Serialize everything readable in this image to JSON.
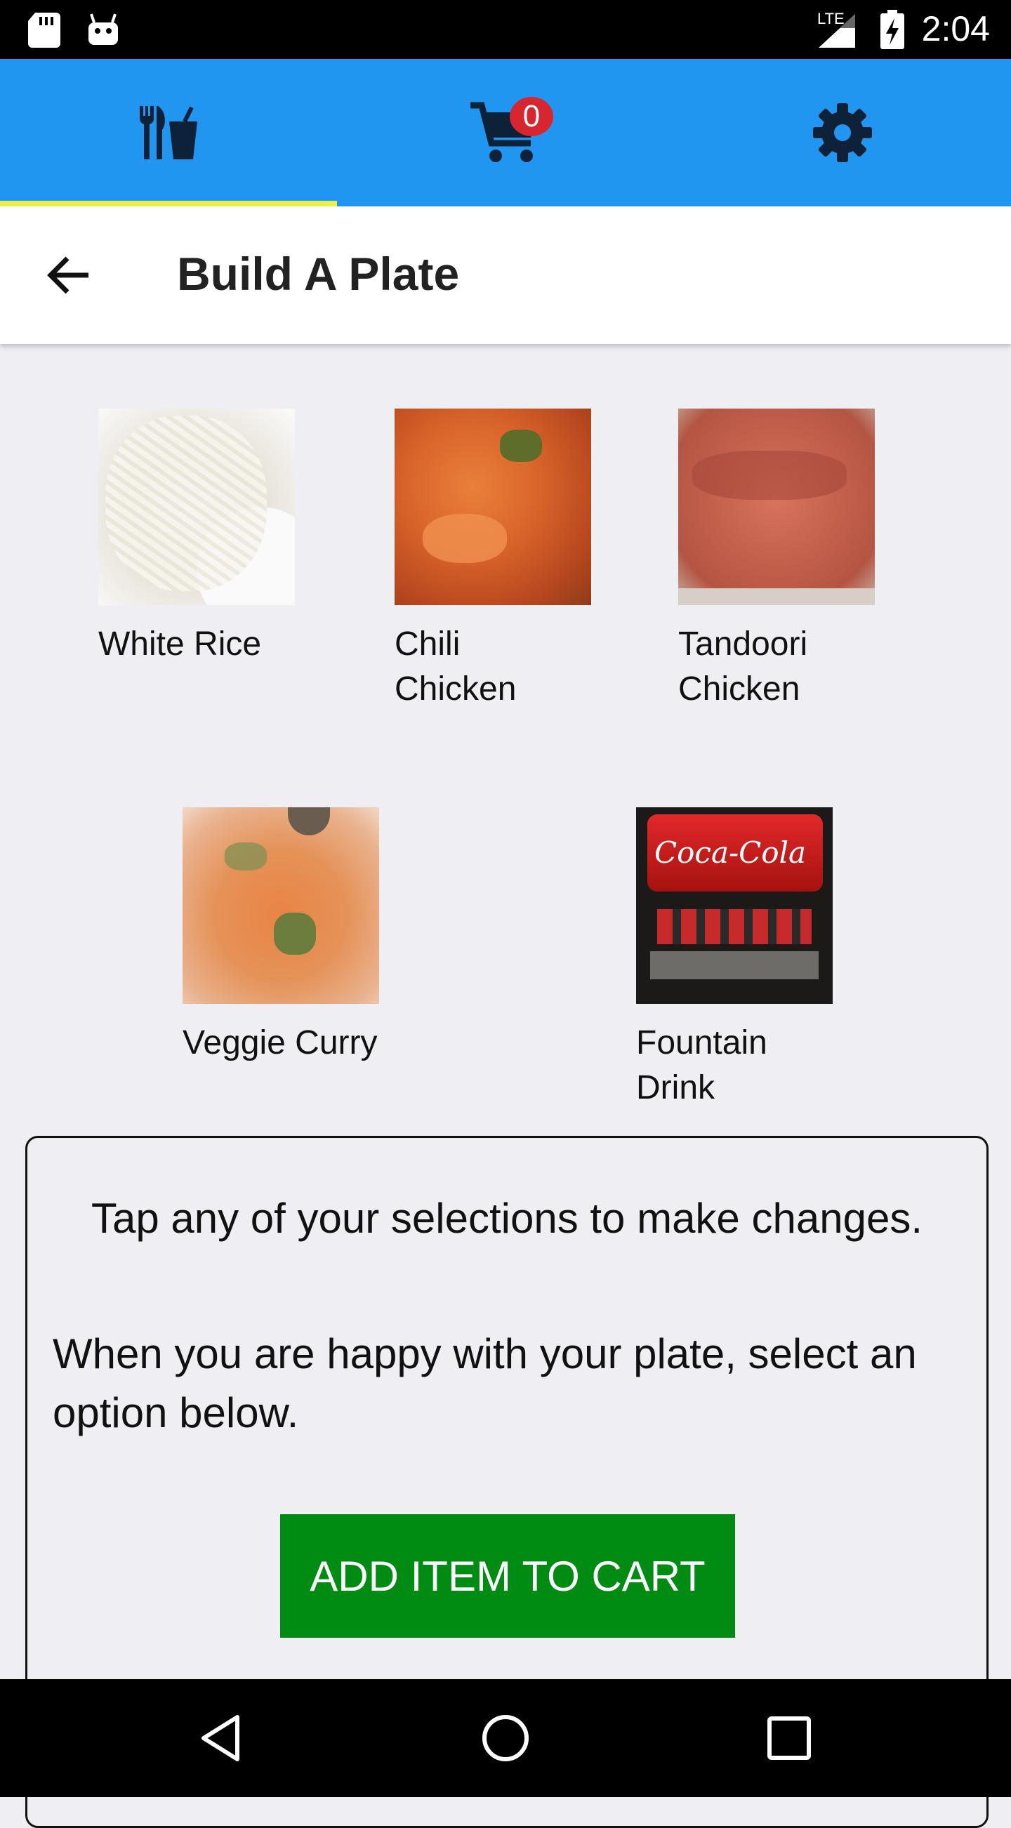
{
  "status_bar": {
    "time": "2:04",
    "network": "LTE"
  },
  "tabs": [
    {
      "name": "menu",
      "icon": "fork-knife-drink-icon",
      "selected": true
    },
    {
      "name": "cart",
      "icon": "cart-icon",
      "badge": "0"
    },
    {
      "name": "settings",
      "icon": "gear-icon"
    }
  ],
  "header": {
    "title": "Build A Plate",
    "back_icon": "arrow-back-icon"
  },
  "items": [
    {
      "label": "White Rice"
    },
    {
      "label": "Chili Chicken"
    },
    {
      "label": "Tandoori Chicken"
    },
    {
      "label": "Veggie Curry"
    },
    {
      "label": "Fountain Drink",
      "image_logo_text": "Coca-Cola"
    }
  ],
  "info": {
    "line1": "Tap any of your selections to make changes.",
    "line2": "When you are happy with your plate, select an option below.",
    "button": "ADD ITEM TO CART"
  },
  "colors": {
    "tabbar": "#2196f0",
    "indicator": "#e8ee4c",
    "icon": "#0d2239",
    "badge": "#d7262f",
    "button": "#008c12"
  }
}
